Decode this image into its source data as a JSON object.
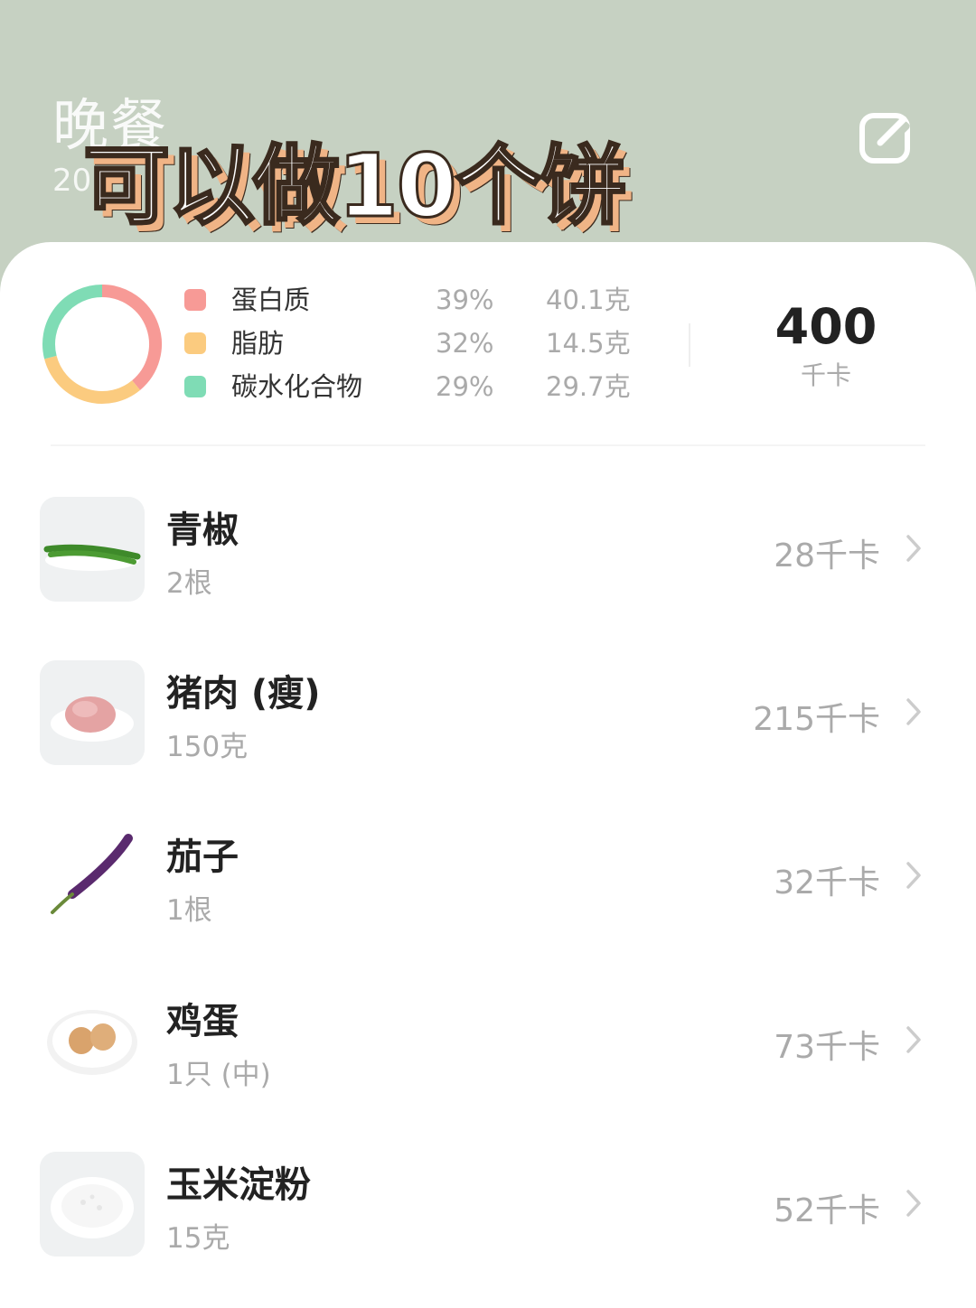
{
  "header": {
    "title": "晚餐",
    "date_partial": "20",
    "caption": "可以做10个饼",
    "edit_icon": "edit-icon"
  },
  "summary": {
    "macros": [
      {
        "name": "蛋白质",
        "percent": "39%",
        "amount": "40.1克",
        "color": "#f79a96"
      },
      {
        "name": "脂肪",
        "percent": "32%",
        "amount": "14.5克",
        "color": "#fbcb7f"
      },
      {
        "name": "碳水化合物",
        "percent": "29%",
        "amount": "29.7克",
        "color": "#7fdcb5"
      }
    ],
    "total_value": "400",
    "total_unit": "千卡"
  },
  "foods": [
    {
      "name": "青椒",
      "quantity": "2根",
      "calories": "28千卡",
      "icon": "green-pepper-photo"
    },
    {
      "name": "猪肉 (瘦)",
      "quantity": "150克",
      "calories": "215千卡",
      "icon": "lean-pork-photo"
    },
    {
      "name": "茄子",
      "quantity": "1根",
      "calories": "32千卡",
      "icon": "eggplant-photo"
    },
    {
      "name": "鸡蛋",
      "quantity": "1只 (中)",
      "calories": "73千卡",
      "icon": "egg-photo"
    },
    {
      "name": "玉米淀粉",
      "quantity": "15克",
      "calories": "52千卡",
      "icon": "corn-starch-photo"
    }
  ]
}
